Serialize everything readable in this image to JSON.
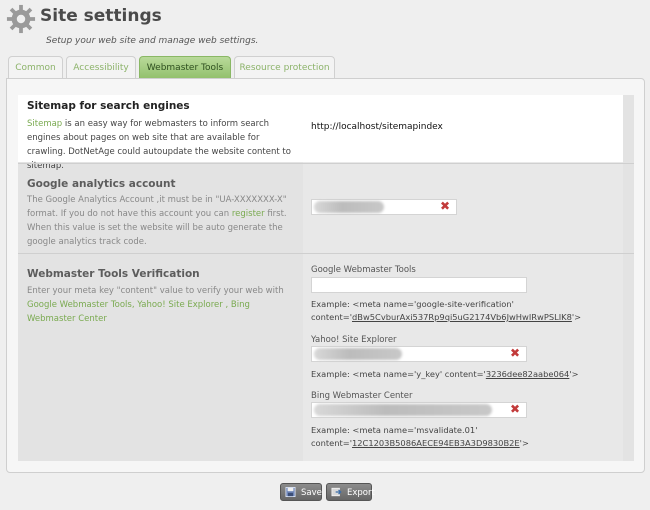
{
  "header": {
    "title": "Site settings",
    "subtitle": "Setup your web site and manage web settings."
  },
  "tabs": [
    {
      "label": "Common",
      "active": false
    },
    {
      "label": "Accessibility",
      "active": false
    },
    {
      "label": "Webmaster Tools",
      "active": true
    },
    {
      "label": "Resource protection",
      "active": false
    }
  ],
  "sitemap": {
    "title": "Sitemap for search engines",
    "link_text": "Sitemap",
    "desc_rest": " is an easy way for webmasters to inform search engines about pages on web site that are available for crawling. DotNetAge could autoupdate the website content to sitemap.",
    "value": "http://localhost/sitemapindex"
  },
  "analytics": {
    "title": "Google analytics account",
    "desc_before": "The Google Analytics Account ,it must be in \"UA-XXXXXXX-X\" format. If you do not have this account you can ",
    "desc_link": "register",
    "desc_after": " first. When this value is set the website will be auto generate the google analytics track code."
  },
  "verification": {
    "title": "Webmaster Tools Verification",
    "desc_before": "Enter your meta key \"content\" value to verify your web with ",
    "desc_links": "Google Webmaster Tools, Yahoo! Site Explorer , Bing Webmaster Center",
    "google": {
      "label": "Google Webmaster Tools",
      "example_prefix": "Example: <meta name='google-site-verification'",
      "example_content_prefix": "content='",
      "example_key": "dBw5CvburAxi537Rp9qi5uG2174Vb6JwHwIRwPSLIK8",
      "example_suffix": "'>"
    },
    "yahoo": {
      "label": "Yahoo! Site Explorer",
      "example_prefix": "Example: <meta name='y_key' content='",
      "example_key": "3236dee82aabe064",
      "example_suffix": "'>"
    },
    "bing": {
      "label": "Bing Webmaster Center",
      "example_prefix": "Example: <meta name='msvalidate.01'",
      "example_content_prefix": "content='",
      "example_key": "12C1203B5086AECE94EB3A3D9830B2E",
      "example_suffix": "'>"
    }
  },
  "buttons": {
    "save": "Save",
    "export": "Export"
  },
  "icons": {
    "clear": "✖"
  },
  "colors": {
    "accent_green": "#8cb36a",
    "clear_red": "#c23a3a"
  }
}
